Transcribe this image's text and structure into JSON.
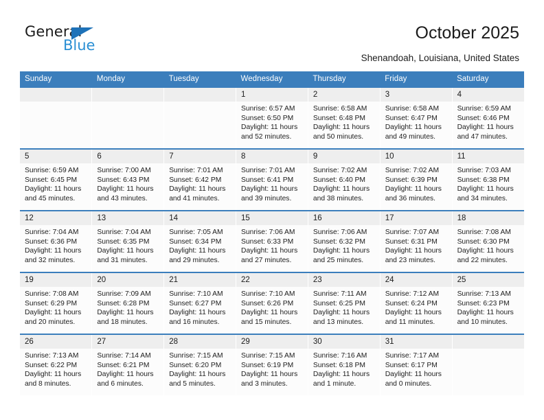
{
  "brand": {
    "name_top": "General",
    "name_bottom": "Blue",
    "accent_color": "#3b7ebc"
  },
  "header": {
    "title": "October 2025",
    "location": "Shenandoah, Louisiana, United States"
  },
  "weekday_headers": [
    "Sunday",
    "Monday",
    "Tuesday",
    "Wednesday",
    "Thursday",
    "Friday",
    "Saturday"
  ],
  "weeks": [
    [
      {
        "day": "",
        "sunrise": "",
        "sunset": "",
        "daylight_1": "",
        "daylight_2": ""
      },
      {
        "day": "",
        "sunrise": "",
        "sunset": "",
        "daylight_1": "",
        "daylight_2": ""
      },
      {
        "day": "",
        "sunrise": "",
        "sunset": "",
        "daylight_1": "",
        "daylight_2": ""
      },
      {
        "day": "1",
        "sunrise": "Sunrise: 6:57 AM",
        "sunset": "Sunset: 6:50 PM",
        "daylight_1": "Daylight: 11 hours",
        "daylight_2": "and 52 minutes."
      },
      {
        "day": "2",
        "sunrise": "Sunrise: 6:58 AM",
        "sunset": "Sunset: 6:48 PM",
        "daylight_1": "Daylight: 11 hours",
        "daylight_2": "and 50 minutes."
      },
      {
        "day": "3",
        "sunrise": "Sunrise: 6:58 AM",
        "sunset": "Sunset: 6:47 PM",
        "daylight_1": "Daylight: 11 hours",
        "daylight_2": "and 49 minutes."
      },
      {
        "day": "4",
        "sunrise": "Sunrise: 6:59 AM",
        "sunset": "Sunset: 6:46 PM",
        "daylight_1": "Daylight: 11 hours",
        "daylight_2": "and 47 minutes."
      }
    ],
    [
      {
        "day": "5",
        "sunrise": "Sunrise: 6:59 AM",
        "sunset": "Sunset: 6:45 PM",
        "daylight_1": "Daylight: 11 hours",
        "daylight_2": "and 45 minutes."
      },
      {
        "day": "6",
        "sunrise": "Sunrise: 7:00 AM",
        "sunset": "Sunset: 6:43 PM",
        "daylight_1": "Daylight: 11 hours",
        "daylight_2": "and 43 minutes."
      },
      {
        "day": "7",
        "sunrise": "Sunrise: 7:01 AM",
        "sunset": "Sunset: 6:42 PM",
        "daylight_1": "Daylight: 11 hours",
        "daylight_2": "and 41 minutes."
      },
      {
        "day": "8",
        "sunrise": "Sunrise: 7:01 AM",
        "sunset": "Sunset: 6:41 PM",
        "daylight_1": "Daylight: 11 hours",
        "daylight_2": "and 39 minutes."
      },
      {
        "day": "9",
        "sunrise": "Sunrise: 7:02 AM",
        "sunset": "Sunset: 6:40 PM",
        "daylight_1": "Daylight: 11 hours",
        "daylight_2": "and 38 minutes."
      },
      {
        "day": "10",
        "sunrise": "Sunrise: 7:02 AM",
        "sunset": "Sunset: 6:39 PM",
        "daylight_1": "Daylight: 11 hours",
        "daylight_2": "and 36 minutes."
      },
      {
        "day": "11",
        "sunrise": "Sunrise: 7:03 AM",
        "sunset": "Sunset: 6:38 PM",
        "daylight_1": "Daylight: 11 hours",
        "daylight_2": "and 34 minutes."
      }
    ],
    [
      {
        "day": "12",
        "sunrise": "Sunrise: 7:04 AM",
        "sunset": "Sunset: 6:36 PM",
        "daylight_1": "Daylight: 11 hours",
        "daylight_2": "and 32 minutes."
      },
      {
        "day": "13",
        "sunrise": "Sunrise: 7:04 AM",
        "sunset": "Sunset: 6:35 PM",
        "daylight_1": "Daylight: 11 hours",
        "daylight_2": "and 31 minutes."
      },
      {
        "day": "14",
        "sunrise": "Sunrise: 7:05 AM",
        "sunset": "Sunset: 6:34 PM",
        "daylight_1": "Daylight: 11 hours",
        "daylight_2": "and 29 minutes."
      },
      {
        "day": "15",
        "sunrise": "Sunrise: 7:06 AM",
        "sunset": "Sunset: 6:33 PM",
        "daylight_1": "Daylight: 11 hours",
        "daylight_2": "and 27 minutes."
      },
      {
        "day": "16",
        "sunrise": "Sunrise: 7:06 AM",
        "sunset": "Sunset: 6:32 PM",
        "daylight_1": "Daylight: 11 hours",
        "daylight_2": "and 25 minutes."
      },
      {
        "day": "17",
        "sunrise": "Sunrise: 7:07 AM",
        "sunset": "Sunset: 6:31 PM",
        "daylight_1": "Daylight: 11 hours",
        "daylight_2": "and 23 minutes."
      },
      {
        "day": "18",
        "sunrise": "Sunrise: 7:08 AM",
        "sunset": "Sunset: 6:30 PM",
        "daylight_1": "Daylight: 11 hours",
        "daylight_2": "and 22 minutes."
      }
    ],
    [
      {
        "day": "19",
        "sunrise": "Sunrise: 7:08 AM",
        "sunset": "Sunset: 6:29 PM",
        "daylight_1": "Daylight: 11 hours",
        "daylight_2": "and 20 minutes."
      },
      {
        "day": "20",
        "sunrise": "Sunrise: 7:09 AM",
        "sunset": "Sunset: 6:28 PM",
        "daylight_1": "Daylight: 11 hours",
        "daylight_2": "and 18 minutes."
      },
      {
        "day": "21",
        "sunrise": "Sunrise: 7:10 AM",
        "sunset": "Sunset: 6:27 PM",
        "daylight_1": "Daylight: 11 hours",
        "daylight_2": "and 16 minutes."
      },
      {
        "day": "22",
        "sunrise": "Sunrise: 7:10 AM",
        "sunset": "Sunset: 6:26 PM",
        "daylight_1": "Daylight: 11 hours",
        "daylight_2": "and 15 minutes."
      },
      {
        "day": "23",
        "sunrise": "Sunrise: 7:11 AM",
        "sunset": "Sunset: 6:25 PM",
        "daylight_1": "Daylight: 11 hours",
        "daylight_2": "and 13 minutes."
      },
      {
        "day": "24",
        "sunrise": "Sunrise: 7:12 AM",
        "sunset": "Sunset: 6:24 PM",
        "daylight_1": "Daylight: 11 hours",
        "daylight_2": "and 11 minutes."
      },
      {
        "day": "25",
        "sunrise": "Sunrise: 7:13 AM",
        "sunset": "Sunset: 6:23 PM",
        "daylight_1": "Daylight: 11 hours",
        "daylight_2": "and 10 minutes."
      }
    ],
    [
      {
        "day": "26",
        "sunrise": "Sunrise: 7:13 AM",
        "sunset": "Sunset: 6:22 PM",
        "daylight_1": "Daylight: 11 hours",
        "daylight_2": "and 8 minutes."
      },
      {
        "day": "27",
        "sunrise": "Sunrise: 7:14 AM",
        "sunset": "Sunset: 6:21 PM",
        "daylight_1": "Daylight: 11 hours",
        "daylight_2": "and 6 minutes."
      },
      {
        "day": "28",
        "sunrise": "Sunrise: 7:15 AM",
        "sunset": "Sunset: 6:20 PM",
        "daylight_1": "Daylight: 11 hours",
        "daylight_2": "and 5 minutes."
      },
      {
        "day": "29",
        "sunrise": "Sunrise: 7:15 AM",
        "sunset": "Sunset: 6:19 PM",
        "daylight_1": "Daylight: 11 hours",
        "daylight_2": "and 3 minutes."
      },
      {
        "day": "30",
        "sunrise": "Sunrise: 7:16 AM",
        "sunset": "Sunset: 6:18 PM",
        "daylight_1": "Daylight: 11 hours",
        "daylight_2": "and 1 minute."
      },
      {
        "day": "31",
        "sunrise": "Sunrise: 7:17 AM",
        "sunset": "Sunset: 6:17 PM",
        "daylight_1": "Daylight: 11 hours",
        "daylight_2": "and 0 minutes."
      },
      {
        "day": "",
        "sunrise": "",
        "sunset": "",
        "daylight_1": "",
        "daylight_2": ""
      }
    ]
  ]
}
